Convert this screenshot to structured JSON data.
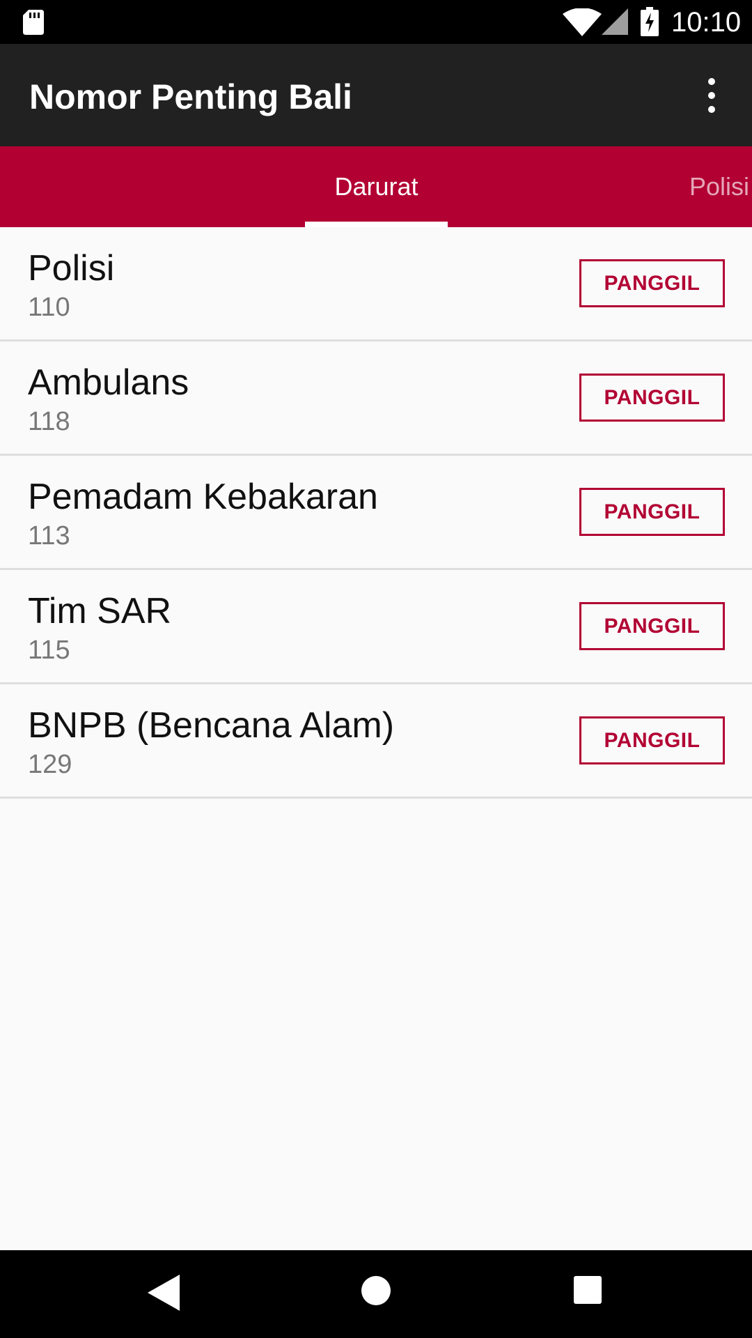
{
  "status_bar": {
    "time": "10:10",
    "icons": [
      "sd-card-icon",
      "wifi-icon",
      "signal-icon",
      "battery-charging-icon"
    ]
  },
  "app_bar": {
    "title": "Nomor Penting Bali",
    "overflow_icon": "more-vert-icon"
  },
  "tabs": {
    "items": [
      {
        "label": "Darurat",
        "selected": true
      },
      {
        "label": "Polisi",
        "selected": false
      }
    ]
  },
  "contacts": [
    {
      "name": "Polisi",
      "number": "110",
      "action": "PANGGIL"
    },
    {
      "name": "Ambulans",
      "number": "118",
      "action": "PANGGIL"
    },
    {
      "name": "Pemadam Kebakaran",
      "number": "113",
      "action": "PANGGIL"
    },
    {
      "name": "Tim SAR",
      "number": "115",
      "action": "PANGGIL"
    },
    {
      "name": "BNPB (Bencana Alam)",
      "number": "129",
      "action": "PANGGIL"
    }
  ],
  "nav_bar": {
    "icons": [
      "back-icon",
      "home-icon",
      "recents-icon"
    ]
  },
  "colors": {
    "accent": "#b20033",
    "app_bar": "#212121",
    "background": "#fafafa"
  }
}
